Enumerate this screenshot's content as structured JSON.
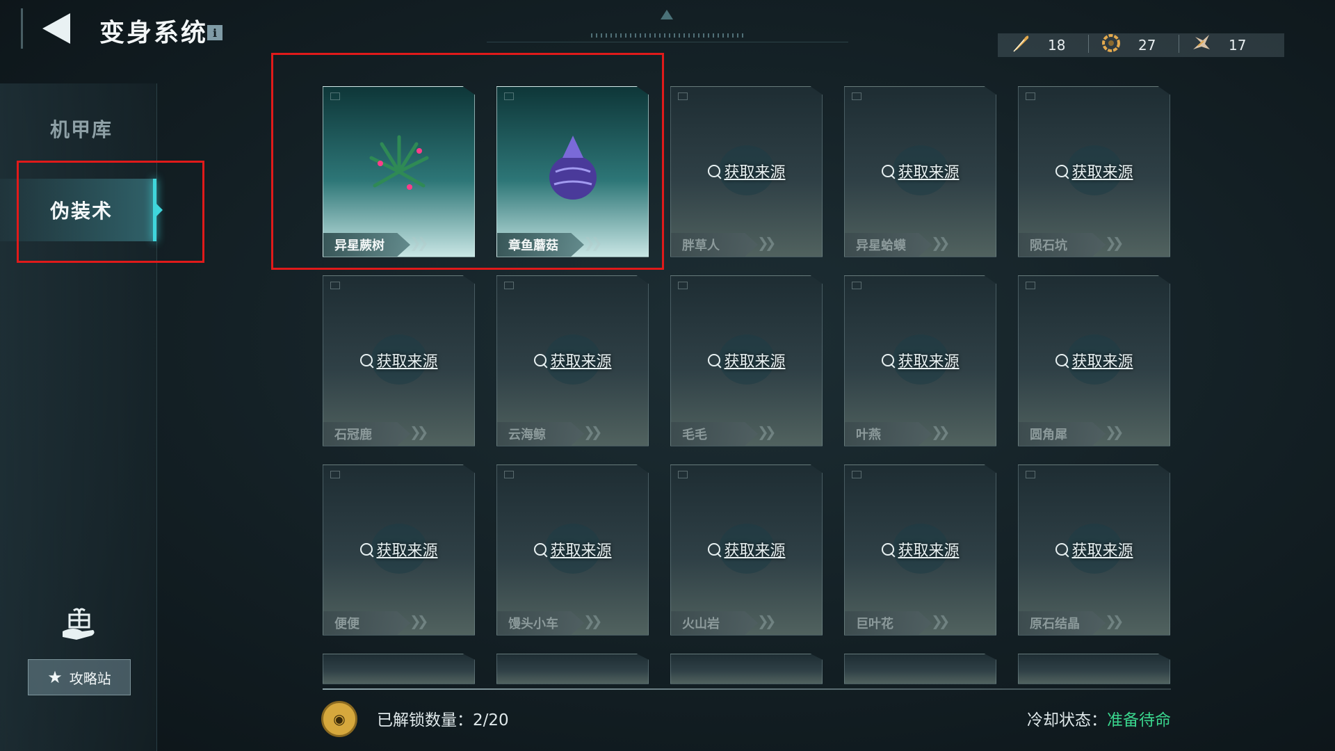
{
  "header": {
    "title": "变身系统",
    "info_icon": "i"
  },
  "currencies": [
    {
      "icon": "feather-icon",
      "value": "18"
    },
    {
      "icon": "ring-icon",
      "value": "27"
    },
    {
      "icon": "wing-icon",
      "value": "17"
    }
  ],
  "sidebar": {
    "items": [
      {
        "label": "机甲库",
        "active": false
      },
      {
        "label": "伪装术",
        "active": true
      }
    ],
    "guide_label": "攻略站"
  },
  "cards": [
    {
      "name": "异星蕨树",
      "unlocked": true,
      "source": ""
    },
    {
      "name": "章鱼蘑菇",
      "unlocked": true,
      "source": ""
    },
    {
      "name": "胖草人",
      "unlocked": false,
      "source": "获取来源"
    },
    {
      "name": "异星蛤蟆",
      "unlocked": false,
      "source": "获取来源"
    },
    {
      "name": "陨石坑",
      "unlocked": false,
      "source": "获取来源"
    },
    {
      "name": "石冠鹿",
      "unlocked": false,
      "source": "获取来源"
    },
    {
      "name": "云海鲸",
      "unlocked": false,
      "source": "获取来源"
    },
    {
      "name": "毛毛",
      "unlocked": false,
      "source": "获取来源"
    },
    {
      "name": "叶燕",
      "unlocked": false,
      "source": "获取来源"
    },
    {
      "name": "圆角犀",
      "unlocked": false,
      "source": "获取来源"
    },
    {
      "name": "便便",
      "unlocked": false,
      "source": "获取来源"
    },
    {
      "name": "馒头小车",
      "unlocked": false,
      "source": "获取来源"
    },
    {
      "name": "火山岩",
      "unlocked": false,
      "source": "获取来源"
    },
    {
      "name": "巨叶花",
      "unlocked": false,
      "source": "获取来源"
    },
    {
      "name": "原石结晶",
      "unlocked": false,
      "source": "获取来源"
    }
  ],
  "footer": {
    "unlock_label": "已解锁数量：2/20",
    "cool_label": "冷却状态：",
    "cool_status": "准备待命"
  },
  "colors": {
    "accent": "#3fd6dc",
    "highlight_box": "#e01a1a",
    "status_ready": "#3ad68e",
    "coin": "#d6a83d"
  }
}
